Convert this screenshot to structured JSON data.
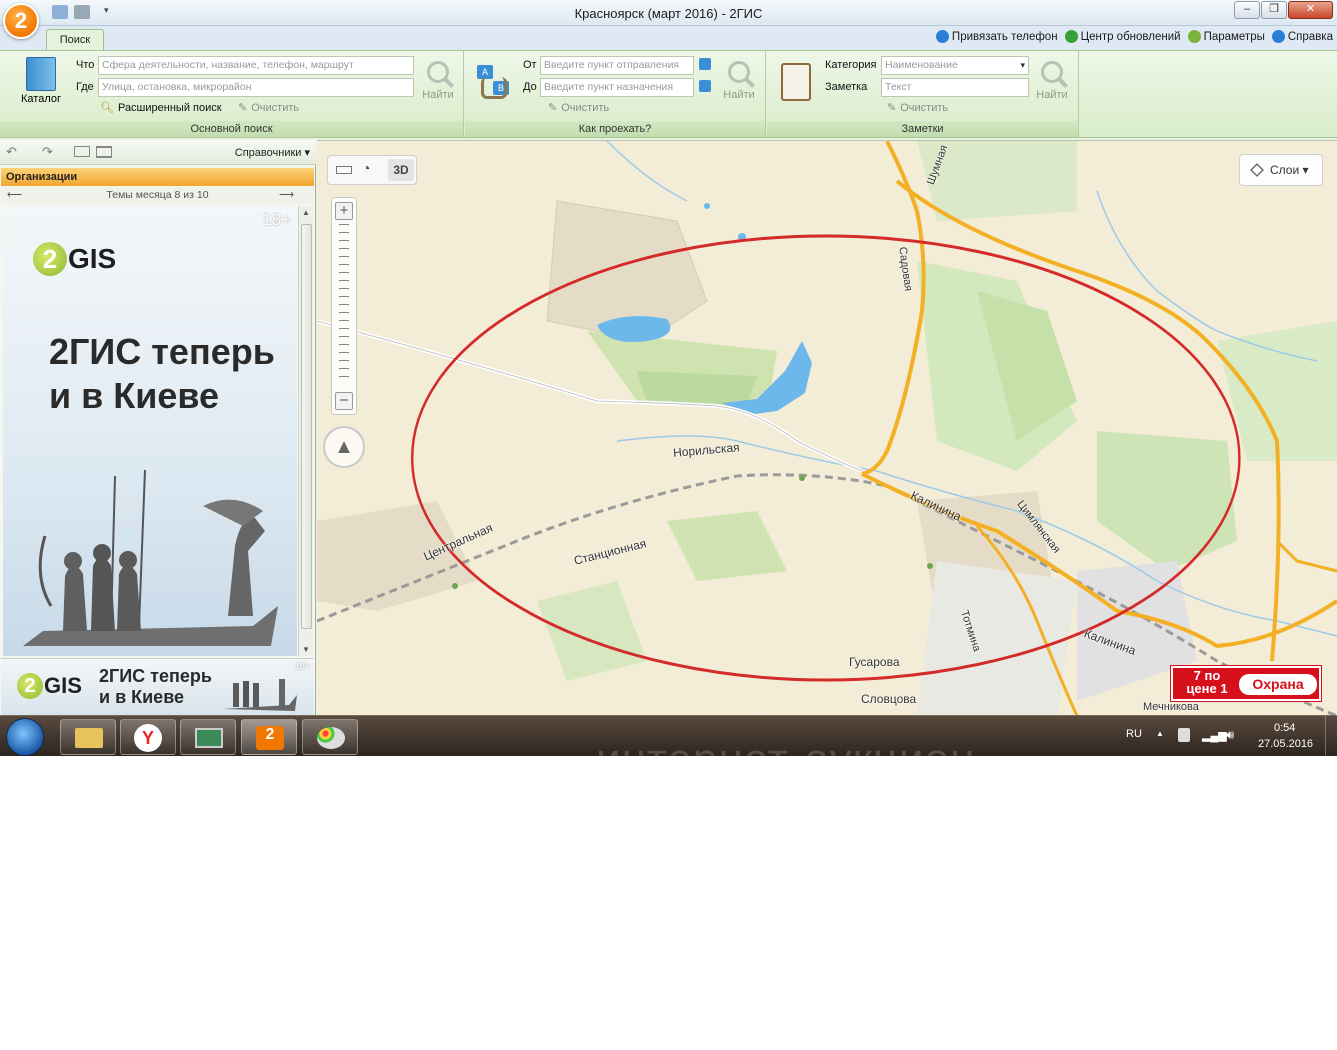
{
  "window": {
    "title": "Красноярск (март 2016) - 2ГИС",
    "controls": [
      "–",
      "❐",
      "✕"
    ]
  },
  "ribbon_tabs": {
    "active": "Поиск"
  },
  "top_links": [
    {
      "label": "Привязать телефон",
      "icon": "phone-link-icon",
      "color": "#2a7fd4"
    },
    {
      "label": "Центр обновлений",
      "icon": "update-icon",
      "color": "#3aa03a"
    },
    {
      "label": "Параметры",
      "icon": "settings-icon",
      "color": "#7bb33a"
    },
    {
      "label": "Справка",
      "icon": "help-icon",
      "color": "#2a7fd4"
    }
  ],
  "basic_search": {
    "group_label": "Основной поиск",
    "catalog_label": "Каталог",
    "what_label": "Что",
    "what_placeholder": "Сфера деятельности, название, телефон, маршрут",
    "where_label": "Где",
    "where_placeholder": "Улица, остановка, микрорайон",
    "find_label": "Найти",
    "advanced_label": "Расширенный поиск",
    "clear_label": "Очистить"
  },
  "route": {
    "group_label": "Как проехать?",
    "from_label": "От",
    "from_placeholder": "Введите пункт отправления",
    "to_label": "До",
    "to_placeholder": "Введите пункт назначения",
    "find_label": "Найти",
    "clear_label": "Очистить"
  },
  "notes": {
    "group_label": "Заметки",
    "category_label": "Категория",
    "category_value": "Наименование",
    "note_label": "Заметка",
    "note_placeholder": "Текст",
    "find_label": "Найти",
    "clear_label": "Очистить"
  },
  "sidebar": {
    "directories_label": "Справочники",
    "orgs_header": "Организации",
    "themes_nav": "Темы месяца 8 из 10",
    "banner_age": "18+",
    "banner_logo": "GIS",
    "banner_logo_digit": "2",
    "banner_line1": "2ГИС теперь",
    "banner_line2": "и в Киеве",
    "mini_age": "18+",
    "mini_line1": "2ГИС теперь",
    "mini_line2": "и в Киеве"
  },
  "map": {
    "tool_3d": "3D",
    "zoom_in": "+",
    "zoom_out": "−",
    "layers_label": "Слои",
    "labels": {
      "shumnaya": "Шумная",
      "sadovaya": "Садовая",
      "norilskaya": "Норильская",
      "kalinina1": "Калинина",
      "tsimlyanskaya": "Цимлянская",
      "tsentralnaya": "Центральная",
      "stantsionnaya": "Станционная",
      "totmina": "Тотмина",
      "kalinina2": "Калинина",
      "gusarova": "Гусарова",
      "slovtsova": "Словцова",
      "mechnikova": "Мечникова"
    },
    "promo_line1": "7 по",
    "promo_line2": "цене 1",
    "promo_brand": "Охрана",
    "highlight_color": "#d42a2a"
  },
  "taskbar": {
    "lang": "RU",
    "time": "0:54",
    "date": "27.05.2016",
    "watermark": "интернет-аукцион"
  }
}
